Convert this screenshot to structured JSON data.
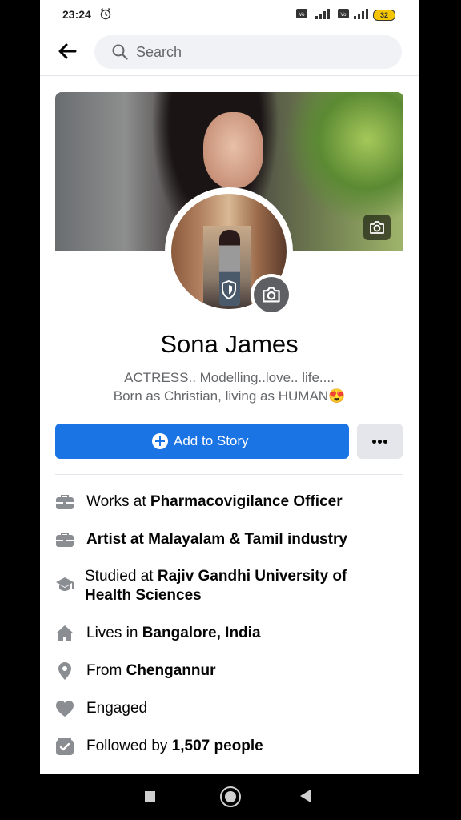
{
  "status_bar": {
    "time": "23:24",
    "battery": "32",
    "alarm_icon": "alarm-clock-icon"
  },
  "search": {
    "placeholder": "Search"
  },
  "profile": {
    "name": "Sona James",
    "bio_line1": "ACTRESS.. Modelling..love.. life....",
    "bio_line2": "Born as Christian,  living as HUMAN😍"
  },
  "actions": {
    "add_story": "Add to Story",
    "more": "..."
  },
  "details": [
    {
      "icon": "briefcase-icon",
      "prefix": "Works at ",
      "bold": "Pharmacovigilance Officer"
    },
    {
      "icon": "briefcase-icon",
      "prefix": "",
      "bold": "Artist  at Malayalam & Tamil industry"
    },
    {
      "icon": "graduation-cap-icon",
      "prefix": "Studied at ",
      "bold": "Rajiv Gandhi University of",
      "bold2": "Health Sciences"
    },
    {
      "icon": "home-icon",
      "prefix": "Lives in ",
      "bold": "Bangalore, India"
    },
    {
      "icon": "location-pin-icon",
      "prefix": "From ",
      "bold": "Chengannur"
    },
    {
      "icon": "heart-icon",
      "prefix": "Engaged",
      "bold": ""
    },
    {
      "icon": "followers-icon",
      "prefix": "Followed by ",
      "bold": "1,507 people"
    }
  ],
  "colors": {
    "primary": "#1b74e4",
    "icon_gray": "#8a8d91",
    "text": "#050505",
    "secondary_text": "#65676b"
  }
}
